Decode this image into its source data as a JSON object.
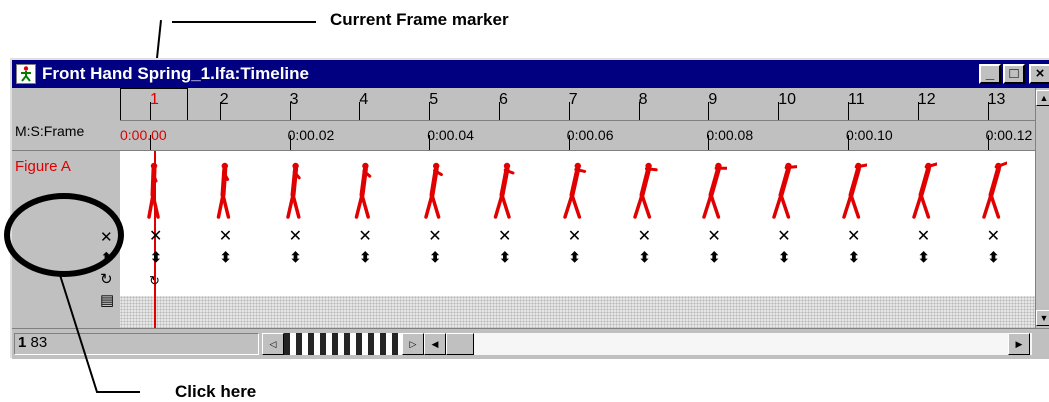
{
  "callouts": {
    "current_frame": "Current Frame marker",
    "click_here": "Click here"
  },
  "window": {
    "title": "Front Hand Spring_1.lfa:Timeline",
    "min_glyph": "_",
    "max_glyph": "□",
    "close_glyph": "×"
  },
  "ruler": {
    "label": "M:S:Frame",
    "frames": [
      "1",
      "2",
      "3",
      "4",
      "5",
      "6",
      "7",
      "8",
      "9",
      "10",
      "11",
      "12",
      "13",
      "1"
    ],
    "times": [
      "0:00.00",
      "0:00.02",
      "0:00.04",
      "0:00.06",
      "0:00.08",
      "0:00.10",
      "0:00.12"
    ]
  },
  "track": {
    "figure_label": "Figure A",
    "row_icons": [
      "cross-icon",
      "updown-arrow-icon",
      "loop-arrow-icon",
      "notes-icon"
    ]
  },
  "status": {
    "frame_counter_bold": "1",
    "frame_counter": "83"
  },
  "colors": {
    "title_bar": "#000080",
    "figure": "#e00000",
    "chrome": "#c0c0c0"
  }
}
